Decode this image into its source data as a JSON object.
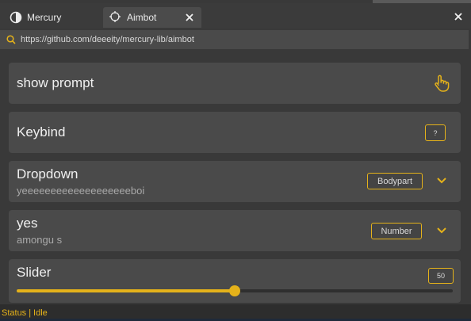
{
  "tabs": [
    {
      "label": "Mercury",
      "icon": "mercury-logo-icon"
    },
    {
      "label": "Aimbot",
      "icon": "crosshair-icon",
      "active": true
    }
  ],
  "url": "https://github.com/deeeity/mercury-lib/aimbot",
  "items": {
    "prompt": {
      "title": "show prompt",
      "icon": "hand-pointer-icon"
    },
    "keybind": {
      "title": "Keybind",
      "key": "?"
    },
    "dropdown1": {
      "title": "Dropdown",
      "subtitle": "yeeeeeeeeeeeeeeeeeeeboi",
      "value": "Bodypart"
    },
    "dropdown2": {
      "title": "yes",
      "subtitle": "amongu s",
      "value": "Number"
    },
    "slider": {
      "title": "Slider",
      "value": "50",
      "min": 0,
      "max": 100,
      "fraction": 0.5
    }
  },
  "status": {
    "label": "Status",
    "separator": "|",
    "value": "Idle"
  },
  "colors": {
    "accent": "#e5b21a",
    "card": "#4a4a4a",
    "background": "#393939"
  }
}
